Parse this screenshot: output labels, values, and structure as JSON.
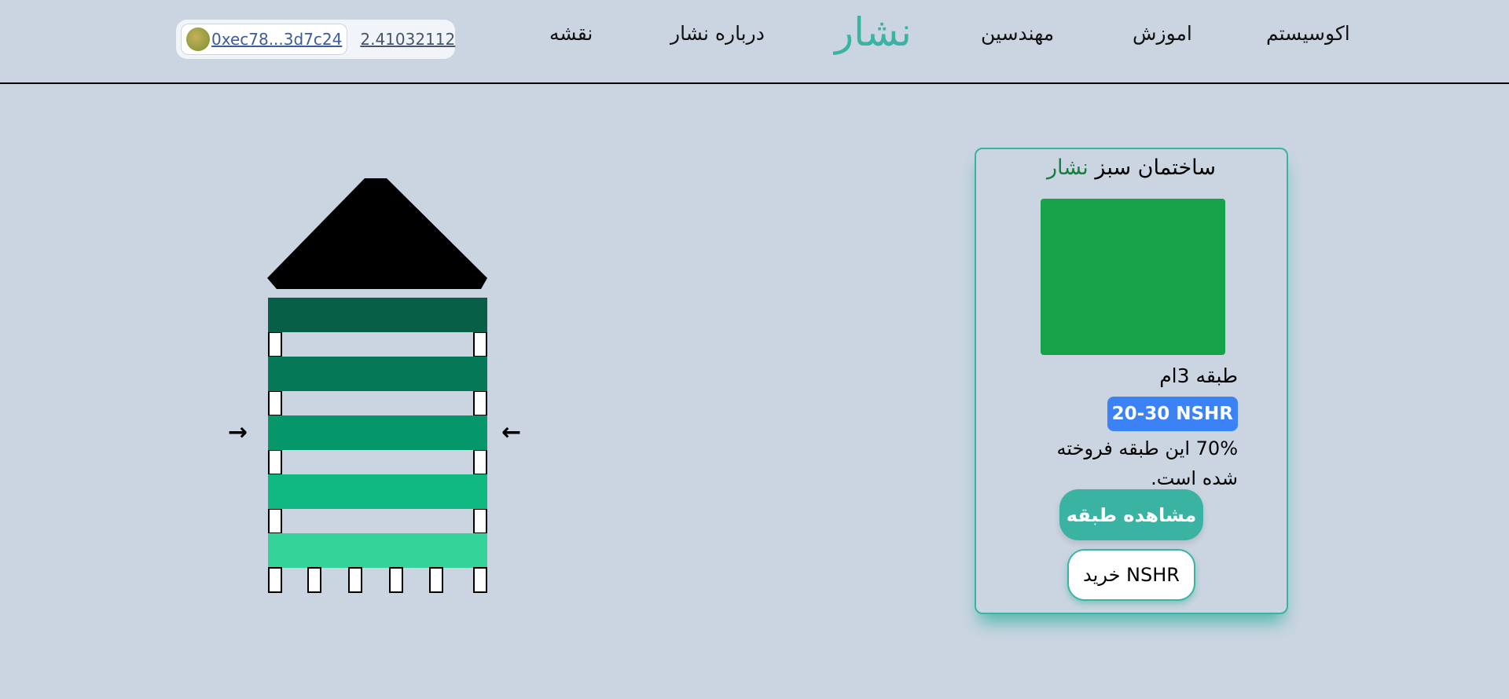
{
  "header": {
    "wallet": {
      "address": "0xec78...3d7c24",
      "balance": "2.41032112"
    },
    "nav": {
      "map": "نقشه",
      "about": "درباره نشار",
      "brand": "نشار",
      "engineers": "مهندسین",
      "education": "اموزش",
      "ecosystem": "اکوسیستم"
    }
  },
  "building": {
    "floor_colors": [
      "#065f46",
      "#047857",
      "#059669",
      "#10b981",
      "#34d399"
    ],
    "roof_color": "#000000",
    "left_arrow": "→",
    "right_arrow": "←"
  },
  "card": {
    "title_prefix": "ساختمان سبز",
    "title_accent": "نشار",
    "accent_color": "#15803d",
    "image_color": "#16a34a",
    "floor_label": "طبقه 3ام",
    "price": "20-30 NSHR",
    "sold_text": "70% این طبقه فروخته شده است.",
    "view_button": "مشاهده طبقه",
    "buy_button": "خرید NSHR"
  }
}
